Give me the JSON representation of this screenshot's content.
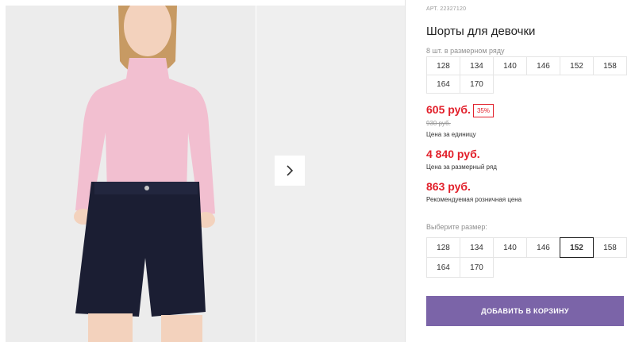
{
  "product": {
    "article": "АРТ. 22327120",
    "title": "Шорты для девочки"
  },
  "size_row": {
    "caption": "8 шт. в размерном ряду",
    "sizes": [
      "128",
      "134",
      "140",
      "146",
      "152",
      "158",
      "164",
      "170"
    ]
  },
  "pricing": {
    "unit_price": "605 руб.",
    "discount": "35%",
    "old_price": "930 руб.",
    "unit_label": "Цена за единицу",
    "row_price": "4 840 руб.",
    "row_label": "Цена за размерный ряд",
    "retail_price": "863 руб.",
    "retail_label": "Рекомендуемая розничная цена"
  },
  "size_select": {
    "caption": "Выберите размер:",
    "sizes": [
      "128",
      "134",
      "140",
      "146",
      "152",
      "158",
      "164",
      "170"
    ],
    "selected": "152"
  },
  "cart": {
    "label": "ДОБАВИТЬ В КОРЗИНУ"
  },
  "colors": {
    "accent": "#7b64a8",
    "price": "#e2202b",
    "sweater": "#f2bfd0",
    "shorts": "#1b1e33"
  },
  "icons": {
    "next": "chevron-right-icon"
  }
}
